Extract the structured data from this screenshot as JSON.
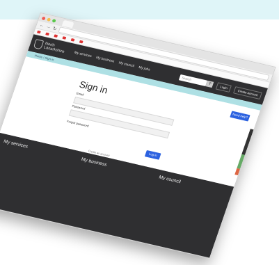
{
  "browser": {
    "tab_title": "",
    "url": "",
    "bookmarks": [
      "",
      "",
      "",
      "",
      "",
      "",
      "",
      ""
    ]
  },
  "header": {
    "logo_text": "North Lanarkshire",
    "nav": [
      "My services",
      "My business",
      "My council",
      "My jobs"
    ],
    "search_placeholder": "Search",
    "search_icon": "magnifier-icon",
    "register_label": "Login",
    "account_label": "Create account"
  },
  "breadcrumb": "Home / Sign in",
  "signin": {
    "title": "Sign in",
    "need_help_label": "Need help?",
    "email_label": "Email",
    "password_label": "Password",
    "remember_label": "Forgot password",
    "login_label": "Log in",
    "register_text": "Create an account",
    "help_text": ""
  },
  "footer": {
    "columns": [
      {
        "title": "My services",
        "links": [
          "",
          "",
          "",
          "",
          "",
          "",
          ""
        ]
      },
      {
        "title": "My business",
        "links": [
          "",
          "",
          "",
          "",
          "",
          "",
          ""
        ]
      },
      {
        "title": "My council",
        "links": [
          "",
          "",
          "",
          "",
          "",
          "",
          ""
        ]
      }
    ]
  }
}
